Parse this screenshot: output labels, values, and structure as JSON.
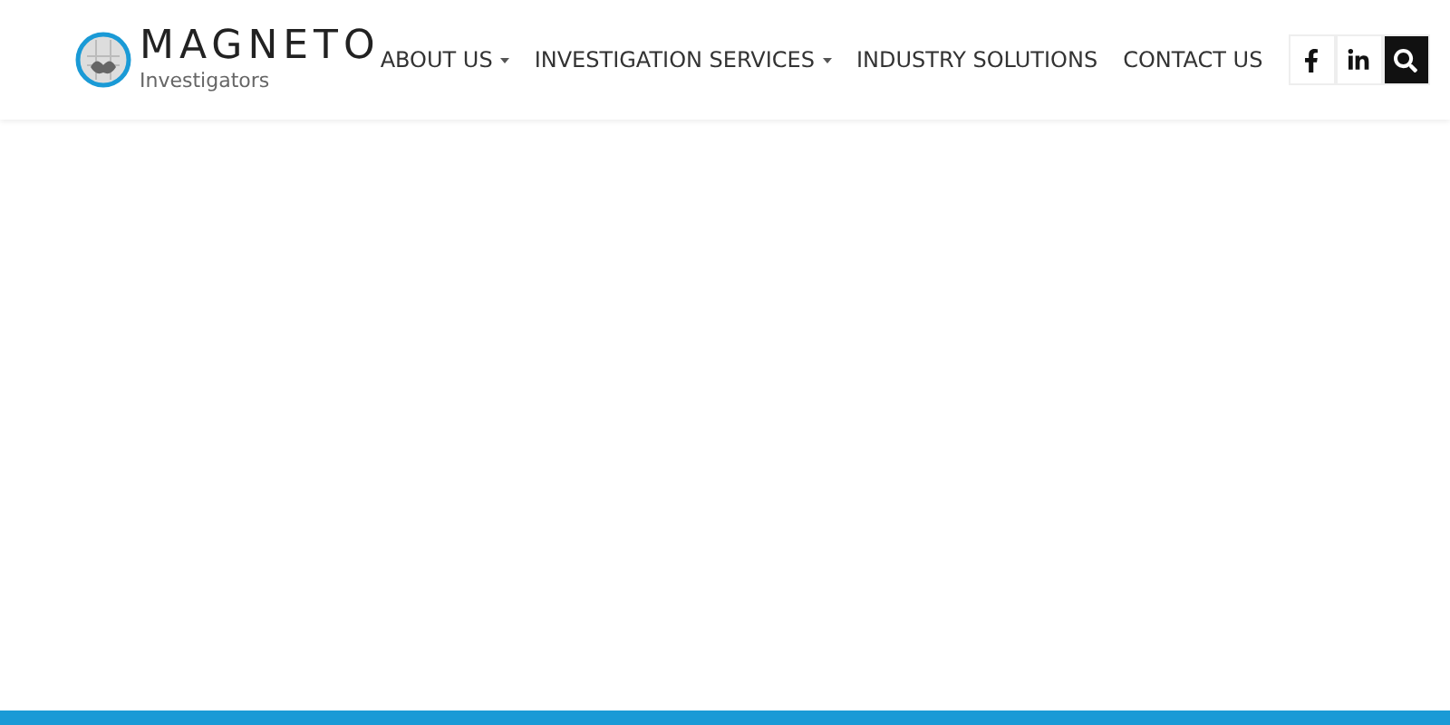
{
  "logo": {
    "name": "MAGNETO",
    "tagline": "Investigators"
  },
  "nav": [
    {
      "label": "ABOUT US",
      "dropdown": true
    },
    {
      "label": "INVESTIGATION SERVICES",
      "dropdown": true
    },
    {
      "label": "INDUSTRY SOLUTIONS",
      "dropdown": false
    },
    {
      "label": "CONTACT US",
      "dropdown": false
    }
  ],
  "social": [
    {
      "kind": "facebook"
    },
    {
      "kind": "linkedin"
    },
    {
      "kind": "search"
    }
  ]
}
